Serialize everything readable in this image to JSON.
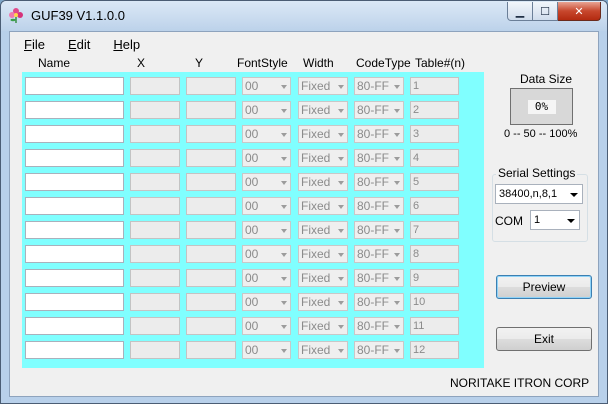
{
  "window": {
    "title": "GUF39 V1.1.0.0",
    "min_glyph": "▁",
    "max_glyph": "☐",
    "close_glyph": "✕"
  },
  "menu": [
    {
      "accel": "F",
      "rest": "ile"
    },
    {
      "accel": "E",
      "rest": "dit"
    },
    {
      "accel": "H",
      "rest": "elp"
    }
  ],
  "table": {
    "headers": [
      "Name",
      "X",
      "Y",
      "FontStyle",
      "Width",
      "CodeType",
      "Table#(n)"
    ],
    "rows": [
      {
        "font_style": "00",
        "width": "Fixed",
        "code_type": "80-FF",
        "table_n": "1"
      },
      {
        "font_style": "00",
        "width": "Fixed",
        "code_type": "80-FF",
        "table_n": "2"
      },
      {
        "font_style": "00",
        "width": "Fixed",
        "code_type": "80-FF",
        "table_n": "3"
      },
      {
        "font_style": "00",
        "width": "Fixed",
        "code_type": "80-FF",
        "table_n": "4"
      },
      {
        "font_style": "00",
        "width": "Fixed",
        "code_type": "80-FF",
        "table_n": "5"
      },
      {
        "font_style": "00",
        "width": "Fixed",
        "code_type": "80-FF",
        "table_n": "6"
      },
      {
        "font_style": "00",
        "width": "Fixed",
        "code_type": "80-FF",
        "table_n": "7"
      },
      {
        "font_style": "00",
        "width": "Fixed",
        "code_type": "80-FF",
        "table_n": "8"
      },
      {
        "font_style": "00",
        "width": "Fixed",
        "code_type": "80-FF",
        "table_n": "9"
      },
      {
        "font_style": "00",
        "width": "Fixed",
        "code_type": "80-FF",
        "table_n": "10"
      },
      {
        "font_style": "00",
        "width": "Fixed",
        "code_type": "80-FF",
        "table_n": "11"
      },
      {
        "font_style": "00",
        "width": "Fixed",
        "code_type": "80-FF",
        "table_n": "12"
      }
    ],
    "panel_color": "#80ffff"
  },
  "data_size": {
    "label": "Data Size",
    "percent_text": "0%",
    "progress_fraction": 0,
    "scale_text": "0 -- 50 -- 100%"
  },
  "serial": {
    "group_title": "Serial Settings",
    "settings_value": "38400,n,8,1",
    "com_label": "COM",
    "com_value": "1"
  },
  "buttons": {
    "preview": "Preview",
    "exit": "Exit"
  },
  "footer": "NORITAKE ITRON CORP"
}
